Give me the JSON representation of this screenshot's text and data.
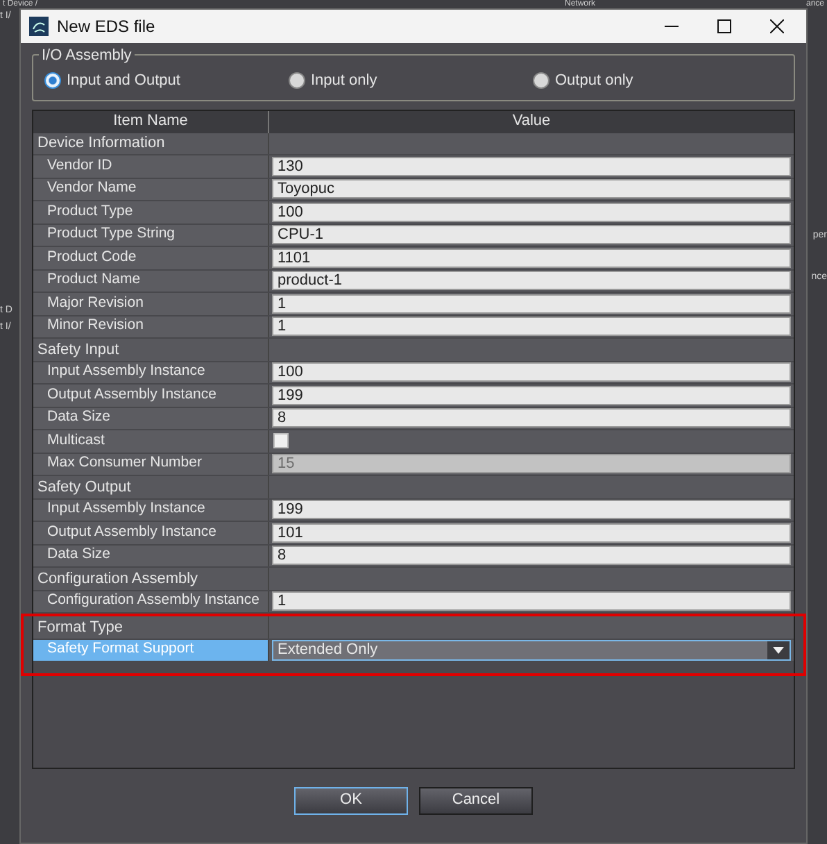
{
  "background": {
    "top_texts": [
      "t Device /",
      "Network",
      "ance"
    ],
    "left_texts": [
      "t I/",
      "t D",
      "t I/"
    ],
    "right_texts": [
      "per",
      "nce"
    ]
  },
  "window": {
    "title": "New EDS file"
  },
  "io_assembly": {
    "title": "I/O Assembly",
    "options": [
      {
        "label": "Input and Output",
        "selected": true
      },
      {
        "label": "Input only",
        "selected": false
      },
      {
        "label": "Output only",
        "selected": false
      }
    ]
  },
  "table": {
    "columns": [
      "Item Name",
      "Value"
    ],
    "groups": [
      {
        "title": "Device Information",
        "highlighted": false,
        "items": [
          {
            "name": "Vendor ID",
            "kind": "text",
            "value": "130",
            "disabled": false,
            "selected": false
          },
          {
            "name": "Vendor Name",
            "kind": "text",
            "value": "Toyopuc",
            "disabled": false,
            "selected": false
          },
          {
            "name": "Product Type",
            "kind": "text",
            "value": "100",
            "disabled": false,
            "selected": false
          },
          {
            "name": "Product Type String",
            "kind": "text",
            "value": "CPU-1",
            "disabled": false,
            "selected": false
          },
          {
            "name": "Product Code",
            "kind": "text",
            "value": "1101",
            "disabled": false,
            "selected": false
          },
          {
            "name": "Product Name",
            "kind": "text",
            "value": "product-1",
            "disabled": false,
            "selected": false
          },
          {
            "name": "Major Revision",
            "kind": "text",
            "value": "1",
            "disabled": false,
            "selected": false
          },
          {
            "name": "Minor Revision",
            "kind": "text",
            "value": "1",
            "disabled": false,
            "selected": false
          }
        ]
      },
      {
        "title": "Safety Input",
        "highlighted": false,
        "items": [
          {
            "name": "Input Assembly Instance",
            "kind": "text",
            "value": "100",
            "disabled": false,
            "selected": false
          },
          {
            "name": "Output Assembly Instance",
            "kind": "text",
            "value": "199",
            "disabled": false,
            "selected": false
          },
          {
            "name": "Data Size",
            "kind": "text",
            "value": "8",
            "disabled": false,
            "selected": false
          },
          {
            "name": "Multicast",
            "kind": "checkbox",
            "checked": false,
            "selected": false
          },
          {
            "name": "Max Consumer Number",
            "kind": "text",
            "value": "15",
            "disabled": true,
            "selected": false
          }
        ]
      },
      {
        "title": "Safety Output",
        "highlighted": false,
        "items": [
          {
            "name": "Input Assembly Instance",
            "kind": "text",
            "value": "199",
            "disabled": false,
            "selected": false
          },
          {
            "name": "Output Assembly Instance",
            "kind": "text",
            "value": "101",
            "disabled": false,
            "selected": false
          },
          {
            "name": "Data Size",
            "kind": "text",
            "value": "8",
            "disabled": false,
            "selected": false
          }
        ]
      },
      {
        "title": "Configuration Assembly",
        "highlighted": false,
        "items": [
          {
            "name": "Configuration Assembly Instance",
            "kind": "text",
            "value": "1",
            "disabled": false,
            "selected": false
          }
        ]
      },
      {
        "title": "Format Type",
        "highlighted": true,
        "items": [
          {
            "name": "Safety Format Support",
            "kind": "dropdown",
            "value": "Extended Only",
            "selected": true
          }
        ]
      }
    ]
  },
  "buttons": [
    {
      "label": "OK",
      "default": true
    },
    {
      "label": "Cancel",
      "default": false
    }
  ]
}
